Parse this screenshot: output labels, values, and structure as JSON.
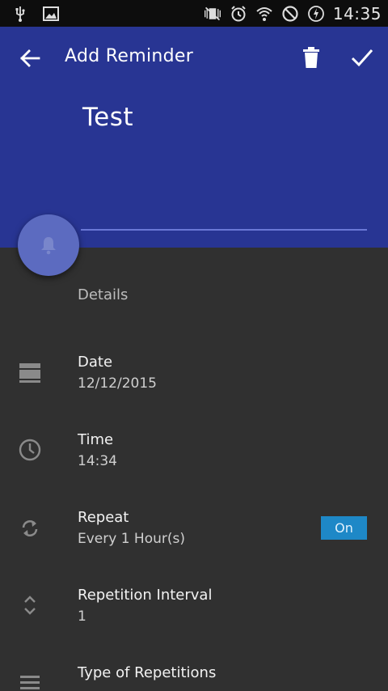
{
  "status_bar": {
    "time": "14:35",
    "left_icons": [
      "usb-icon",
      "image-icon"
    ],
    "right_icons": [
      "vibrate-mute-icon",
      "alarm-icon",
      "wifi-icon",
      "do-not-disturb-icon",
      "battery-charging-icon"
    ]
  },
  "toolbar": {
    "title": "Add Reminder"
  },
  "reminder": {
    "title": "Test"
  },
  "details": {
    "section_label": "Details",
    "rows": [
      {
        "title": "Date",
        "value": "12/12/2015",
        "icon": "calendar-icon"
      },
      {
        "title": "Time",
        "value": "14:34",
        "icon": "clock-icon"
      },
      {
        "title": "Repeat",
        "value": "Every 1 Hour(s)",
        "icon": "repeat-icon"
      },
      {
        "title": "Repetition Interval",
        "value": "1",
        "icon": "unfold-icon"
      },
      {
        "title": "Type of Repetitions",
        "value": "",
        "icon": "list-icon"
      }
    ],
    "repeat_toggle": "On"
  },
  "colors": {
    "header": "#283593",
    "fab": "#5c6bc0",
    "background": "#303030",
    "toggle": "#1e88c7"
  }
}
